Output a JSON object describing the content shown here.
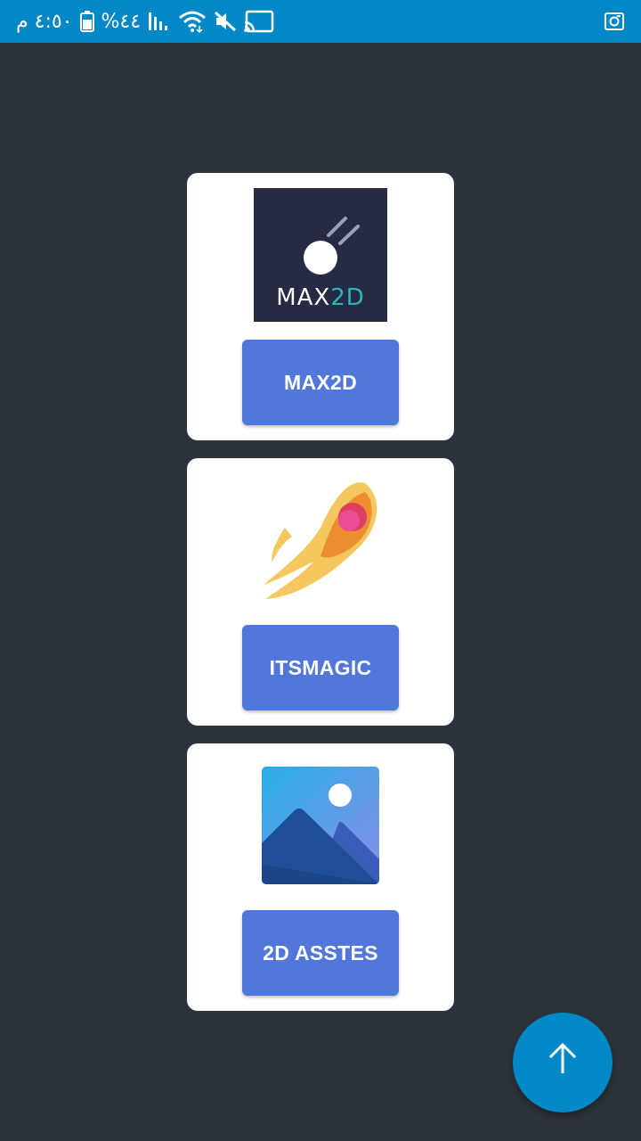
{
  "status_bar": {
    "time": "٤:٥٠ م",
    "battery": "%٤٤",
    "icons": [
      "battery-icon",
      "signal-icon",
      "wifi-icon",
      "mute-icon",
      "cast-icon",
      "screenshot-icon"
    ],
    "color": "#0288c7"
  },
  "cards": [
    {
      "logo": {
        "text_main": "MAX",
        "text_accent": "2D",
        "icon": "max2d-logo-icon"
      },
      "button_label": "MAX2D"
    },
    {
      "logo": {
        "icon": "itsmagic-comet-icon"
      },
      "button_label": "ITSMAGIC"
    },
    {
      "logo": {
        "icon": "image-placeholder-icon"
      },
      "button_label": "2D ASSTES"
    }
  ],
  "fab": {
    "icon": "arrow-up-icon"
  },
  "colors": {
    "background": "#2d333b",
    "card": "#ffffff",
    "button": "#5177dc",
    "accent": "#27b8b8"
  }
}
